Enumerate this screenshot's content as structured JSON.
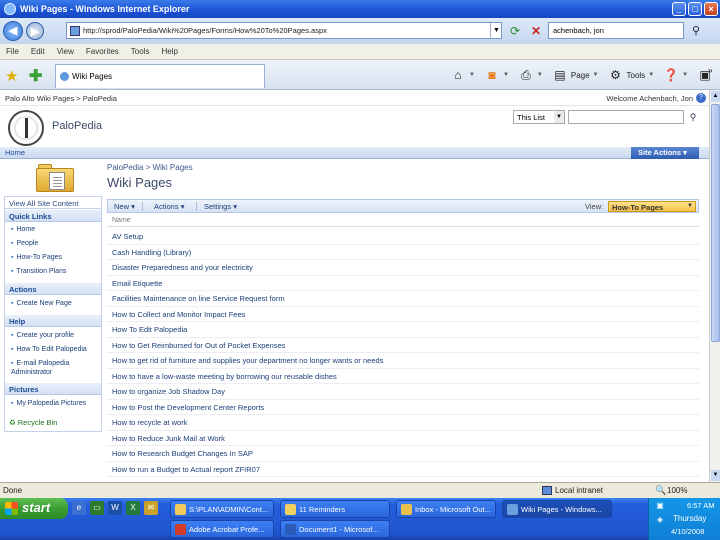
{
  "window": {
    "title": "Wiki Pages - Windows Internet Explorer"
  },
  "address_bar": {
    "url": "http://sprod/PaloPedia/Wiki%20Pages/Forms/How%20To%20Pages.aspx",
    "search_value": "achenbach, jon"
  },
  "menu": [
    "File",
    "Edit",
    "View",
    "Favorites",
    "Tools",
    "Help"
  ],
  "tab": {
    "label": "Wiki Pages"
  },
  "command_bar": {
    "page_label": "Page",
    "tools_label": "Tools",
    "overflow": "»"
  },
  "sp_header": {
    "breadcrumb": "Palo Alto Wiki Pages > PaloPedia",
    "welcome": "Welcome Achenbach, Jon",
    "help": "?",
    "site_title": "PaloPedia",
    "scope": "This List",
    "home_tab": "Home",
    "site_actions": "Site Actions ▾"
  },
  "page": {
    "breadcrumb": "PaloPedia > Wiki Pages",
    "title": "Wiki Pages"
  },
  "quick_launch": {
    "view_all": "View All Site Content",
    "sections": [
      {
        "heading": "Quick Links",
        "items": [
          "Home",
          "People",
          "How-To Pages",
          "Transition Plans"
        ]
      },
      {
        "heading": "Actions",
        "items": [
          "Create New Page"
        ]
      },
      {
        "heading": "Help",
        "items": [
          "Create your profile",
          "How To Edit Palopedia",
          "E-mail Palopedia Administrator"
        ]
      },
      {
        "heading": "Pictures",
        "items": [
          "My Palopedia Pictures"
        ]
      }
    ],
    "recycle": "Recycle Bin"
  },
  "toolbar": {
    "new_label": "New",
    "actions_label": "Actions",
    "settings_label": "Settings",
    "view_label": "View:",
    "view_value": "How-To Pages"
  },
  "list": {
    "column_header": "Name",
    "rows": [
      "AV Setup",
      "Cash Handling (Library)",
      "Disaster Preparedness and your electricity",
      "Email Etiquette",
      "Facilities Maintenance on line Service Request form",
      "How to Collect and Monitor Impact Fees",
      "How To Edit Palopedia",
      "How to Get Reimbursed for Out of Pocket Expenses",
      "How to get rid of furniture and supplies your department no longer wants or needs",
      "How to have a low-waste meeting by borrowing our reusable dishes",
      "How to organize Job Shadow Day",
      "How to Post the Development Center Reports",
      "How to recycle at work",
      "How to Reduce Junk Mail at Work",
      "How to Research Budget Changes In SAP",
      "How to run a Budget to Actual report ZFIR07"
    ]
  },
  "status": {
    "text": "Done",
    "zone": "Local intranet",
    "zoom": "100%"
  },
  "taskbar": {
    "start_label": "start",
    "tasks_row1": [
      "S:\\PLAN\\ADMIN\\Cont...",
      "11 Reminders",
      "Inbox - Microsoft Out...",
      "Wiki Pages - Windows..."
    ],
    "tasks_row2": [
      "Adobe Acrobat Profe...",
      "Document1 - Microsof..."
    ],
    "clock_time": "6:57 AM",
    "clock_day": "Thursday",
    "clock_date": "4/10/2008"
  },
  "colors": {
    "ie_blue": "#1b52d6",
    "sp_link": "#1a3e78",
    "view_highlight": "#f6c148",
    "start_green": "#3a9d32"
  }
}
